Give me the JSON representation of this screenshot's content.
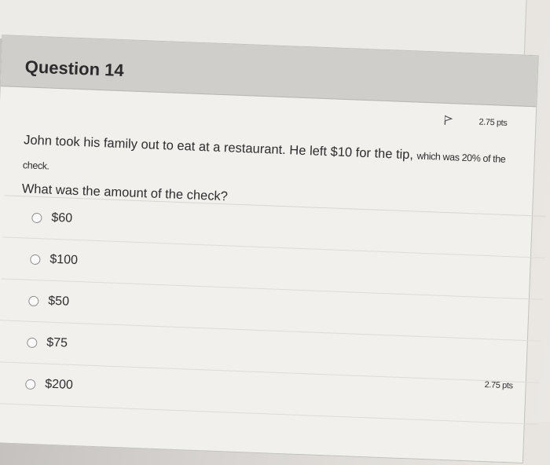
{
  "question": {
    "title": "Question 14",
    "points": "2.75 pts",
    "text_main": "John took his family out to eat at a restaurant. He left $10 for the tip, ",
    "text_small": "which was 20% of the check.",
    "text_line2": "What was the amount of the check?",
    "answers": [
      {
        "label": "$60"
      },
      {
        "label": "$100"
      },
      {
        "label": "$50"
      },
      {
        "label": "$75"
      },
      {
        "label": "$200"
      }
    ],
    "footer_points": "2.75 pts"
  },
  "icons": {
    "flag": "flag-icon"
  }
}
